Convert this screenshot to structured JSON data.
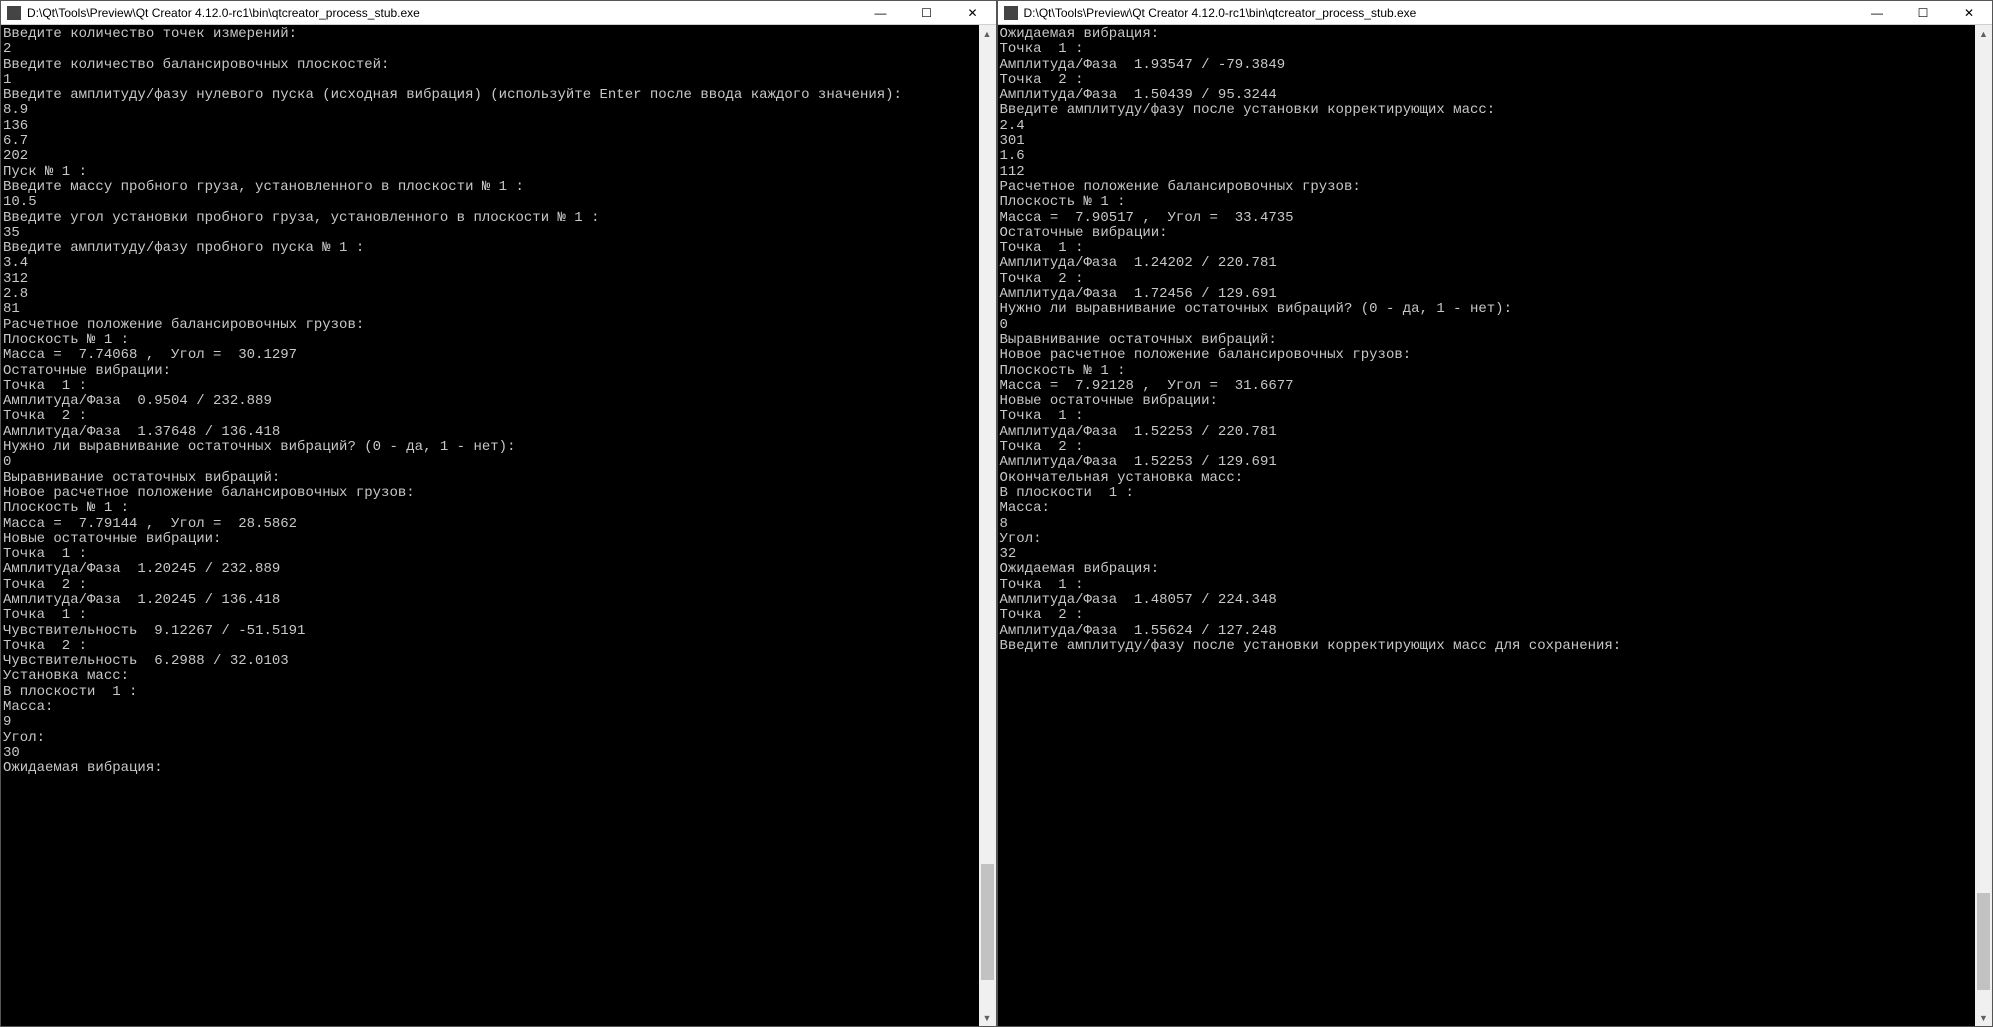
{
  "left_window": {
    "title": "D:\\Qt\\Tools\\Preview\\Qt Creator 4.12.0-rc1\\bin\\qtcreator_process_stub.exe",
    "minimize": "—",
    "maximize": "☐",
    "close": "✕",
    "scroll_up": "▲",
    "scroll_down": "▼",
    "lines": [
      "Введите количество точек измерений:",
      "2",
      "Введите количество балансировочных плоскостей:",
      "1",
      "Введите амплитуду/фазу нулевого пуска (исходная вибрация) (используйте Enter после ввода каждого значения):",
      "8.9",
      "136",
      "6.7",
      "202",
      "Пуск № 1 :",
      "Введите массу пробного груза, установленного в плоскости № 1 :",
      "10.5",
      "Введите угол установки пробного груза, установленного в плоскости № 1 :",
      "35",
      "Введите амплитуду/фазу пробного пуска № 1 :",
      "3.4",
      "312",
      "2.8",
      "81",
      "Расчетное положение балансировочных грузов:",
      "Плоскость № 1 :",
      "Масса =  7.74068 ,  Угол =  30.1297",
      "Остаточные вибрации:",
      "Точка  1 :",
      "Амплитуда/Фаза  0.9504 / 232.889",
      "Точка  2 :",
      "Амплитуда/Фаза  1.37648 / 136.418",
      "Нужно ли выравнивание остаточных вибраций? (0 - да, 1 - нет):",
      "0",
      "Выравнивание остаточных вибраций:",
      "Новое расчетное положение балансировочных грузов:",
      "Плоскость № 1 :",
      "Масса =  7.79144 ,  Угол =  28.5862",
      "Новые остаточные вибрации:",
      "Точка  1 :",
      "Амплитуда/Фаза  1.20245 / 232.889",
      "Точка  2 :",
      "Амплитуда/Фаза  1.20245 / 136.418",
      "Точка  1 :",
      "Чувствительность  9.12267 / -51.5191",
      "Точка  2 :",
      "Чувствительность  6.2988 / 32.0103",
      "Установка масс:",
      "В плоскости  1 :",
      "Масса:",
      "9",
      "Угол:",
      "30",
      "Ожидаемая вибрация:"
    ],
    "thumb": {
      "top_pct": 85,
      "height_pct": 12
    }
  },
  "right_window": {
    "title": "D:\\Qt\\Tools\\Preview\\Qt Creator 4.12.0-rc1\\bin\\qtcreator_process_stub.exe",
    "minimize": "—",
    "maximize": "☐",
    "close": "✕",
    "scroll_up": "▲",
    "scroll_down": "▼",
    "lines": [
      "Ожидаемая вибрация:",
      "Точка  1 :",
      "Амплитуда/Фаза  1.93547 / -79.3849",
      "Точка  2 :",
      "Амплитуда/Фаза  1.50439 / 95.3244",
      "Введите амплитуду/фазу после установки корректирующих масс:",
      "2.4",
      "301",
      "1.6",
      "112",
      "Расчетное положение балансировочных грузов:",
      "Плоскость № 1 :",
      "Масса =  7.90517 ,  Угол =  33.4735",
      "Остаточные вибрации:",
      "Точка  1 :",
      "Амплитуда/Фаза  1.24202 / 220.781",
      "Точка  2 :",
      "Амплитуда/Фаза  1.72456 / 129.691",
      "Нужно ли выравнивание остаточных вибраций? (0 - да, 1 - нет):",
      "0",
      "Выравнивание остаточных вибраций:",
      "Новое расчетное положение балансировочных грузов:",
      "Плоскость № 1 :",
      "Масса =  7.92128 ,  Угол =  31.6677",
      "Новые остаточные вибрации:",
      "Точка  1 :",
      "Амплитуда/Фаза  1.52253 / 220.781",
      "Точка  2 :",
      "Амплитуда/Фаза  1.52253 / 129.691",
      "Окончательная установка масс:",
      "В плоскости  1 :",
      "Масса:",
      "8",
      "Угол:",
      "32",
      "Ожидаемая вибрация:",
      "Точка  1 :",
      "Амплитуда/Фаза  1.48057 / 224.348",
      "Точка  2 :",
      "Амплитуда/Фаза  1.55624 / 127.248",
      "Введите амплитуду/фазу после установки корректирующих масс для сохранения:"
    ],
    "thumb": {
      "top_pct": 88,
      "height_pct": 10
    }
  }
}
